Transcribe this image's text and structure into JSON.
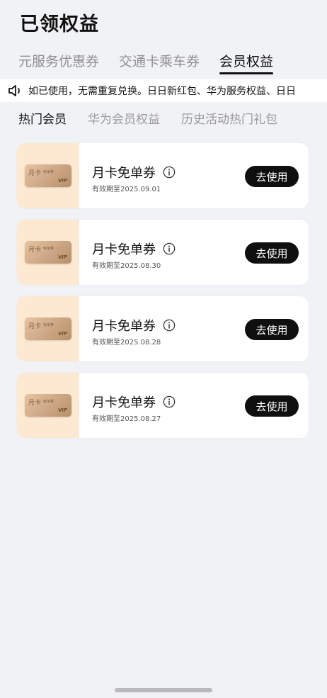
{
  "page": {
    "title": "已领权益"
  },
  "tabs": [
    {
      "label": "元服务优惠券",
      "active": false
    },
    {
      "label": "交通卡乘车券",
      "active": false
    },
    {
      "label": "会员权益",
      "active": true
    }
  ],
  "notice": {
    "text": "如已使用，无需重复兑换。日日新红包、华为服务权益、日日"
  },
  "subtabs": [
    {
      "label": "热门会员",
      "active": true
    },
    {
      "label": "华为会员权益",
      "active": false
    },
    {
      "label": "历史活动热门礼包",
      "active": false
    }
  ],
  "coupons": [
    {
      "name": "月卡免单券",
      "expire": "有效期至2025.09.01",
      "button": "去使用",
      "thumb": {
        "label": "月卡",
        "sub": "免单券",
        "vip": "VIP"
      }
    },
    {
      "name": "月卡免单券",
      "expire": "有效期至2025.08.30",
      "button": "去使用",
      "thumb": {
        "label": "月卡",
        "sub": "免单券",
        "vip": "VIP"
      }
    },
    {
      "name": "月卡免单券",
      "expire": "有效期至2025.08.28",
      "button": "去使用",
      "thumb": {
        "label": "月卡",
        "sub": "免单券",
        "vip": "VIP"
      }
    },
    {
      "name": "月卡免单券",
      "expire": "有效期至2025.08.27",
      "button": "去使用",
      "thumb": {
        "label": "月卡",
        "sub": "免单券",
        "vip": "VIP"
      }
    }
  ],
  "icons": {
    "notice": "speaker-icon",
    "info": "info-icon"
  },
  "colors": {
    "background": "#f1f2f5",
    "card": "#ffffff",
    "thumb_bg": "#fde9d2",
    "button_bg": "#0f0f10",
    "button_text": "#ffffff",
    "tab_inactive": "#8f8f94"
  }
}
